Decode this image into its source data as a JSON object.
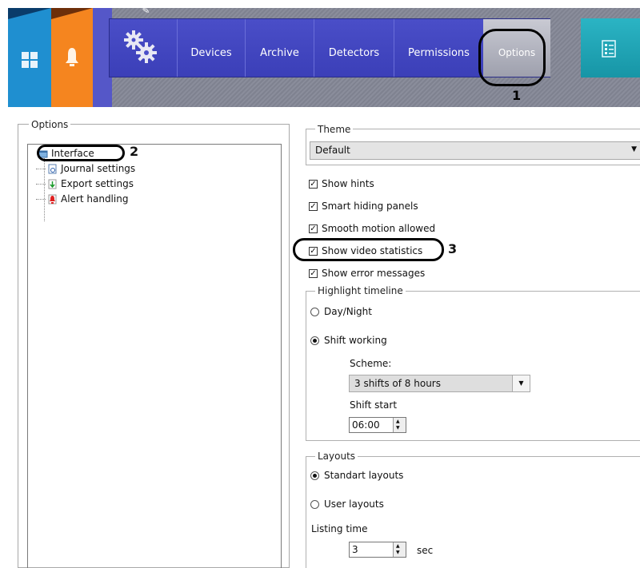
{
  "nav": {
    "items": [
      {
        "label": "Devices"
      },
      {
        "label": "Archive"
      },
      {
        "label": "Detectors"
      },
      {
        "label": "Permissions"
      }
    ],
    "options_label": "Options"
  },
  "annotations": {
    "n1": "1",
    "n2": "2",
    "n3": "3"
  },
  "tree": {
    "group_title": "Options",
    "items": [
      {
        "label": "Interface",
        "icon": "interface-icon"
      },
      {
        "label": "Journal settings",
        "icon": "journal-icon"
      },
      {
        "label": "Export settings",
        "icon": "export-icon"
      },
      {
        "label": "Alert handling",
        "icon": "alert-icon"
      }
    ]
  },
  "theme": {
    "group_title": "Theme",
    "value": "Default"
  },
  "checkboxes": [
    {
      "label": "Show hints",
      "checked": true
    },
    {
      "label": "Smart hiding panels",
      "checked": true
    },
    {
      "label": "Smooth motion allowed",
      "checked": true
    },
    {
      "label": "Show video statistics",
      "checked": true
    },
    {
      "label": "Show error messages",
      "checked": true
    }
  ],
  "highlight": {
    "group_title": "Highlight timeline",
    "day_night": "Day/Night",
    "shift_working": "Shift working",
    "selected": "Shift working",
    "scheme_label": "Scheme:",
    "scheme_value": "3 shifts of 8 hours",
    "shift_start_label": "Shift start",
    "shift_start_value": "06:00"
  },
  "layouts": {
    "group_title": "Layouts",
    "standart": "Standart layouts",
    "user": "User layouts",
    "selected": "Standart layouts",
    "listing_label": "Listing time",
    "listing_value": "3",
    "unit": "sec"
  },
  "colors": {
    "nav_bg": "#4a4ec8",
    "tile_blue": "#1f8fd0",
    "tile_orange": "#f5851f",
    "tile_teal": "#1ea6b6"
  }
}
